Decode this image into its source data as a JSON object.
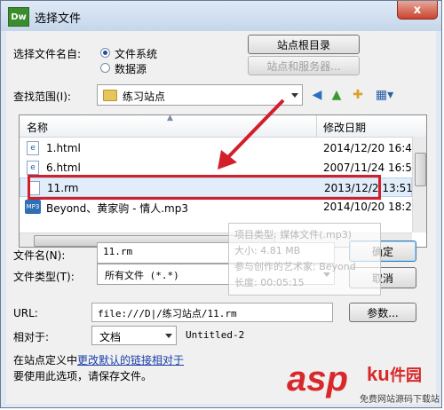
{
  "window": {
    "title": "选择文件",
    "logo": "Dw",
    "close_glyph": "x"
  },
  "select_from": {
    "label": "选择文件名自:",
    "options": [
      {
        "label": "文件系统",
        "selected": true
      },
      {
        "label": "数据源",
        "selected": false
      }
    ]
  },
  "buttons": {
    "site_root": "站点根目录",
    "site_server": "站点和服务器...",
    "ok": "确定",
    "cancel": "取消",
    "params": "参数..."
  },
  "look_in": {
    "label": "查找范围(I):",
    "value": "练习站点"
  },
  "toolbar_icons": [
    "back-icon",
    "up-folder-icon",
    "new-folder-icon",
    "view-menu-icon"
  ],
  "file_list": {
    "columns": [
      "名称",
      "修改日期"
    ],
    "rows": [
      {
        "icon": "html-file-icon",
        "name": "1.html",
        "date": "2014/12/20 16:4",
        "selected": false
      },
      {
        "icon": "html-file-icon",
        "name": "6.html",
        "date": "2007/11/24 16:5",
        "selected": false
      },
      {
        "icon": "generic-file-icon",
        "name": "11.rm",
        "date": "2013/12/2 13:51",
        "selected": true
      },
      {
        "icon": "mp3-file-icon",
        "name": "Beyond、黄家驹 - 情人.mp3",
        "date": "2014/10/20 18:2",
        "selected": false
      }
    ]
  },
  "tooltip": {
    "lines": [
      "项目类型: 媒体文件(.mp3)",
      "大小: 4.81 MB",
      "参与创作的艺术家: Beyond",
      "长度: 00:05:15"
    ]
  },
  "file_name": {
    "label": "文件名(N):",
    "value": "11.rm"
  },
  "file_type": {
    "label": "文件类型(T):",
    "value": "所有文件 (*.*)"
  },
  "url": {
    "label": "URL:",
    "value": "file:///D|/练习站点/11.rm"
  },
  "relative": {
    "label": "相对于:",
    "value": "文档",
    "doc_name": "Untitled-2"
  },
  "note": {
    "prefix": "在站点定义中",
    "link": "更改默认的链接相对于",
    "line2": "要使用此选项，请保存文件。"
  },
  "watermark": {
    "brand": "asp",
    "brand2": "ku",
    "suffix": "件园",
    "sub": "免费网站源码下载站"
  }
}
